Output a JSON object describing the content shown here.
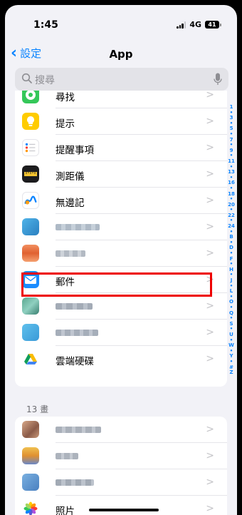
{
  "status_bar": {
    "time": "1:45",
    "network": "4G",
    "battery": "41"
  },
  "nav": {
    "back_label": "設定",
    "title": "App"
  },
  "search": {
    "placeholder": "搜尋"
  },
  "section_header": "13 畫",
  "apps_top": [
    {
      "label": "尋找",
      "icon": "find-my-icon",
      "color": "#34c759"
    },
    {
      "label": "提示",
      "icon": "tips-icon",
      "color": "#ffcc00"
    },
    {
      "label": "提醒事項",
      "icon": "reminders-icon",
      "color": "#ffffff"
    },
    {
      "label": "測距儀",
      "icon": "measure-icon",
      "color": "#1c1c1e"
    },
    {
      "label": "無邊記",
      "icon": "freeform-icon",
      "color": "#ffffff"
    },
    {
      "label": "",
      "icon": "blurred-app-icon",
      "color": "#3aa0d8"
    },
    {
      "label": "",
      "icon": "blurred-app-icon",
      "color": "#e8734a"
    },
    {
      "label": "郵件",
      "icon": "mail-icon",
      "color": "#1a8cff"
    },
    {
      "label": "",
      "icon": "blurred-app-icon",
      "color": "#4a9d8c"
    },
    {
      "label": "",
      "icon": "blurred-app-icon",
      "color": "#4aaee0"
    },
    {
      "label": "雲端硬碟",
      "icon": "google-drive-icon",
      "color": "#ffffff"
    }
  ],
  "apps_bottom": [
    {
      "label": "",
      "icon": "blurred-app-icon",
      "color": "#b07a60"
    },
    {
      "label": "",
      "icon": "blurred-app-icon",
      "color": "#e0b040"
    },
    {
      "label": "",
      "icon": "blurred-app-icon",
      "color": "#5a90c8"
    },
    {
      "label": "照片",
      "icon": "photos-icon",
      "color": "#ffffff"
    }
  ],
  "index_letters": [
    "1",
    "•",
    "3",
    "•",
    "5",
    "•",
    "7",
    "•",
    "9",
    "•",
    "11",
    "•",
    "13",
    "•",
    "16",
    "•",
    "18",
    "•",
    "20",
    "•",
    "22",
    "•",
    "24",
    "•",
    "B",
    "•",
    "D",
    "•",
    "F",
    "•",
    "H",
    "•",
    "J",
    "•",
    "L",
    "•",
    "O",
    "•",
    "Q",
    "•",
    "S",
    "•",
    "U",
    "•",
    "W",
    "•",
    "Y",
    "•",
    "#",
    "Z"
  ],
  "chevron": ">"
}
